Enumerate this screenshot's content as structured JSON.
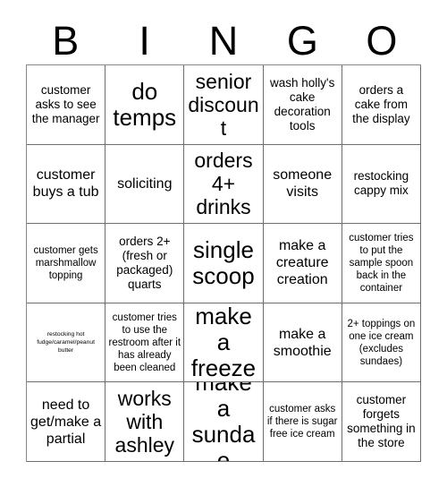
{
  "card": {
    "title": "BINGO",
    "header_letters": [
      "B",
      "I",
      "N",
      "G",
      "O"
    ],
    "columns": 5,
    "rows": 5,
    "colors": {
      "background": "#ffffff",
      "text": "#000000",
      "grid_line": "#6e6e6e"
    },
    "cells": [
      {
        "text": "customer asks to see the manager",
        "size": "sm"
      },
      {
        "text": "do temps",
        "size": "xl"
      },
      {
        "text": "senior discount",
        "size": "lg"
      },
      {
        "text": "wash holly's cake decoration tools",
        "size": "sm"
      },
      {
        "text": "orders a cake from the display",
        "size": "sm"
      },
      {
        "text": "customer buys a tub",
        "size": "md"
      },
      {
        "text": "soliciting",
        "size": "md"
      },
      {
        "text": "orders 4+ drinks",
        "size": "lg"
      },
      {
        "text": "someone visits",
        "size": "md"
      },
      {
        "text": "restocking cappy mix",
        "size": "sm"
      },
      {
        "text": "customer gets marshmallow topping",
        "size": "xs"
      },
      {
        "text": "orders 2+ (fresh or packaged) quarts",
        "size": "sm"
      },
      {
        "text": "single scoop",
        "size": "xl"
      },
      {
        "text": "make a creature creation",
        "size": "md"
      },
      {
        "text": "customer tries to put the sample spoon back in the container",
        "size": "xs"
      },
      {
        "text": "restocking hot fudge/caramel/peanut butter",
        "size": "tiny"
      },
      {
        "text": "customer tries to use the restroom after it has already been cleaned",
        "size": "xs"
      },
      {
        "text": "make a freeze",
        "size": "xl"
      },
      {
        "text": "make a smoothie",
        "size": "md"
      },
      {
        "text": "2+ toppings on one ice cream (excludes sundaes)",
        "size": "xs"
      },
      {
        "text": "need to get/make a partial",
        "size": "md"
      },
      {
        "text": "works with ashley",
        "size": "lg"
      },
      {
        "text": "make a sundae",
        "size": "xl"
      },
      {
        "text": "customer asks if there is sugar free ice cream",
        "size": "xs"
      },
      {
        "text": "customer forgets something in the store",
        "size": "sm"
      }
    ]
  }
}
